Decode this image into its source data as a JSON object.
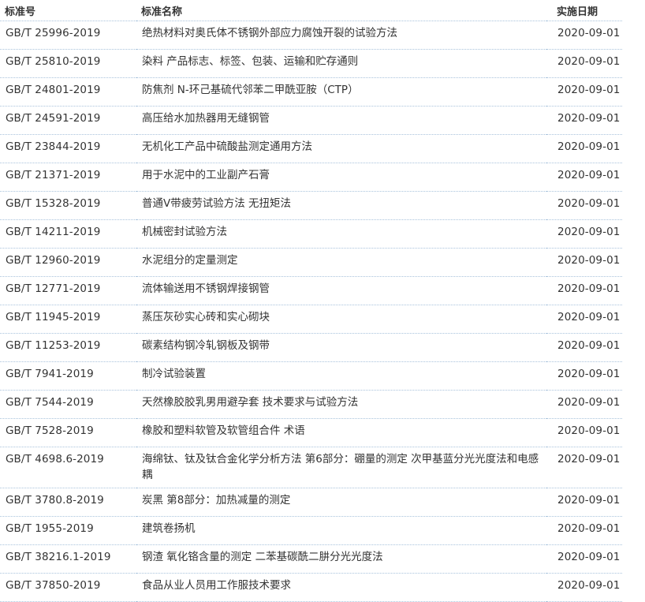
{
  "table": {
    "headers": [
      "标准号",
      "标准名称",
      "实施日期"
    ],
    "rows": [
      {
        "code": "GB/T 25996-2019",
        "name": "绝热材料对奥氏体不锈钢外部应力腐蚀开裂的试验方法",
        "date": "2020-09-01"
      },
      {
        "code": "GB/T 25810-2019",
        "name": "染料 产品标志、标签、包装、运输和贮存通则",
        "date": "2020-09-01"
      },
      {
        "code": "GB/T 24801-2019",
        "name": "防焦剂 N-环己基硫代邻苯二甲酰亚胺（CTP）",
        "date": "2020-09-01"
      },
      {
        "code": "GB/T 24591-2019",
        "name": "高压给水加热器用无缝钢管",
        "date": "2020-09-01"
      },
      {
        "code": "GB/T 23844-2019",
        "name": "无机化工产品中硫酸盐测定通用方法",
        "date": "2020-09-01"
      },
      {
        "code": "GB/T 21371-2019",
        "name": "用于水泥中的工业副产石膏",
        "date": "2020-09-01"
      },
      {
        "code": "GB/T 15328-2019",
        "name": "普通V带疲劳试验方法 无扭矩法",
        "date": "2020-09-01"
      },
      {
        "code": "GB/T 14211-2019",
        "name": "机械密封试验方法",
        "date": "2020-09-01"
      },
      {
        "code": "GB/T 12960-2019",
        "name": "水泥组分的定量测定",
        "date": "2020-09-01"
      },
      {
        "code": "GB/T 12771-2019",
        "name": "流体输送用不锈钢焊接钢管",
        "date": "2020-09-01"
      },
      {
        "code": "GB/T 11945-2019",
        "name": "蒸压灰砂实心砖和实心砌块",
        "date": "2020-09-01"
      },
      {
        "code": "GB/T 11253-2019",
        "name": "碳素结构钢冷轧钢板及钢带",
        "date": "2020-09-01"
      },
      {
        "code": "GB/T 7941-2019",
        "name": "制冷试验装置",
        "date": "2020-09-01"
      },
      {
        "code": "GB/T 7544-2019",
        "name": "天然橡胶胶乳男用避孕套 技术要求与试验方法",
        "date": "2020-09-01"
      },
      {
        "code": "GB/T 7528-2019",
        "name": "橡胶和塑料软管及软管组合件 术语",
        "date": "2020-09-01"
      },
      {
        "code": "GB/T 4698.6-2019",
        "name": "海绵钛、钛及钛合金化学分析方法 第6部分：硼量的测定 次甲基蓝分光光度法和电感耦",
        "date": "2020-09-01"
      },
      {
        "code": "GB/T 3780.8-2019",
        "name": "炭黑 第8部分：加热减量的测定",
        "date": "2020-09-01"
      },
      {
        "code": "GB/T 1955-2019",
        "name": "建筑卷扬机",
        "date": "2020-09-01"
      },
      {
        "code": "GB/T 38216.1-2019",
        "name": "钢渣 氧化铬含量的测定 二苯基碳酰二肼分光光度法",
        "date": "2020-09-01"
      },
      {
        "code": "GB/T 37850-2019",
        "name": "食品从业人员用工作服技术要求",
        "date": "2020-09-01"
      }
    ]
  }
}
